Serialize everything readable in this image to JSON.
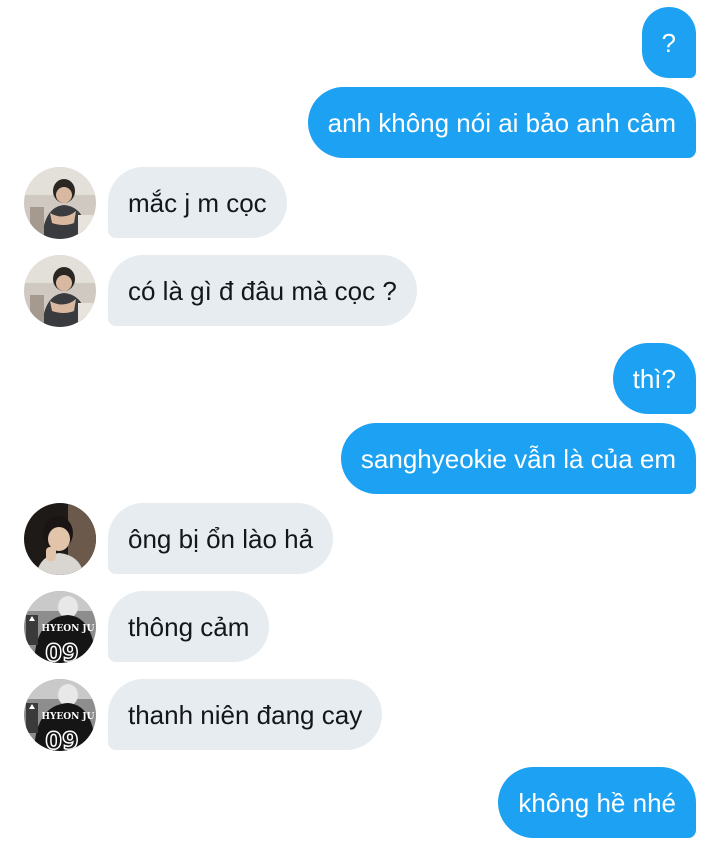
{
  "conversation": {
    "messages": [
      {
        "side": "sent",
        "text": "?"
      },
      {
        "side": "sent",
        "text": "anh không nói ai bảo anh câm"
      },
      {
        "side": "received",
        "text": "mắc j m cọc",
        "avatar": "avatar-photo-sitting"
      },
      {
        "side": "received",
        "text": "có là gì đ đâu mà cọc ?",
        "avatar": "avatar-photo-sitting"
      },
      {
        "side": "sent",
        "text": "thì?"
      },
      {
        "side": "sent",
        "text": "sanghyeokie vẫn là của em"
      },
      {
        "side": "received",
        "text": "ông bị ổn lào hả",
        "avatar": "avatar-photo-portrait"
      },
      {
        "side": "received",
        "text": "thông cảm",
        "avatar": "avatar-photo-jersey",
        "avatar_text": "HYEON JU"
      },
      {
        "side": "received",
        "text": "thanh niên đang cay",
        "avatar": "avatar-photo-jersey",
        "avatar_text": "HYEON JU"
      },
      {
        "side": "sent",
        "text": "không hề nhé"
      }
    ]
  },
  "colors": {
    "sent_bubble": "#1da1f2",
    "received_bubble": "#e6ecf0",
    "sent_text": "#ffffff",
    "received_text": "#14171a",
    "background": "#ffffff"
  }
}
